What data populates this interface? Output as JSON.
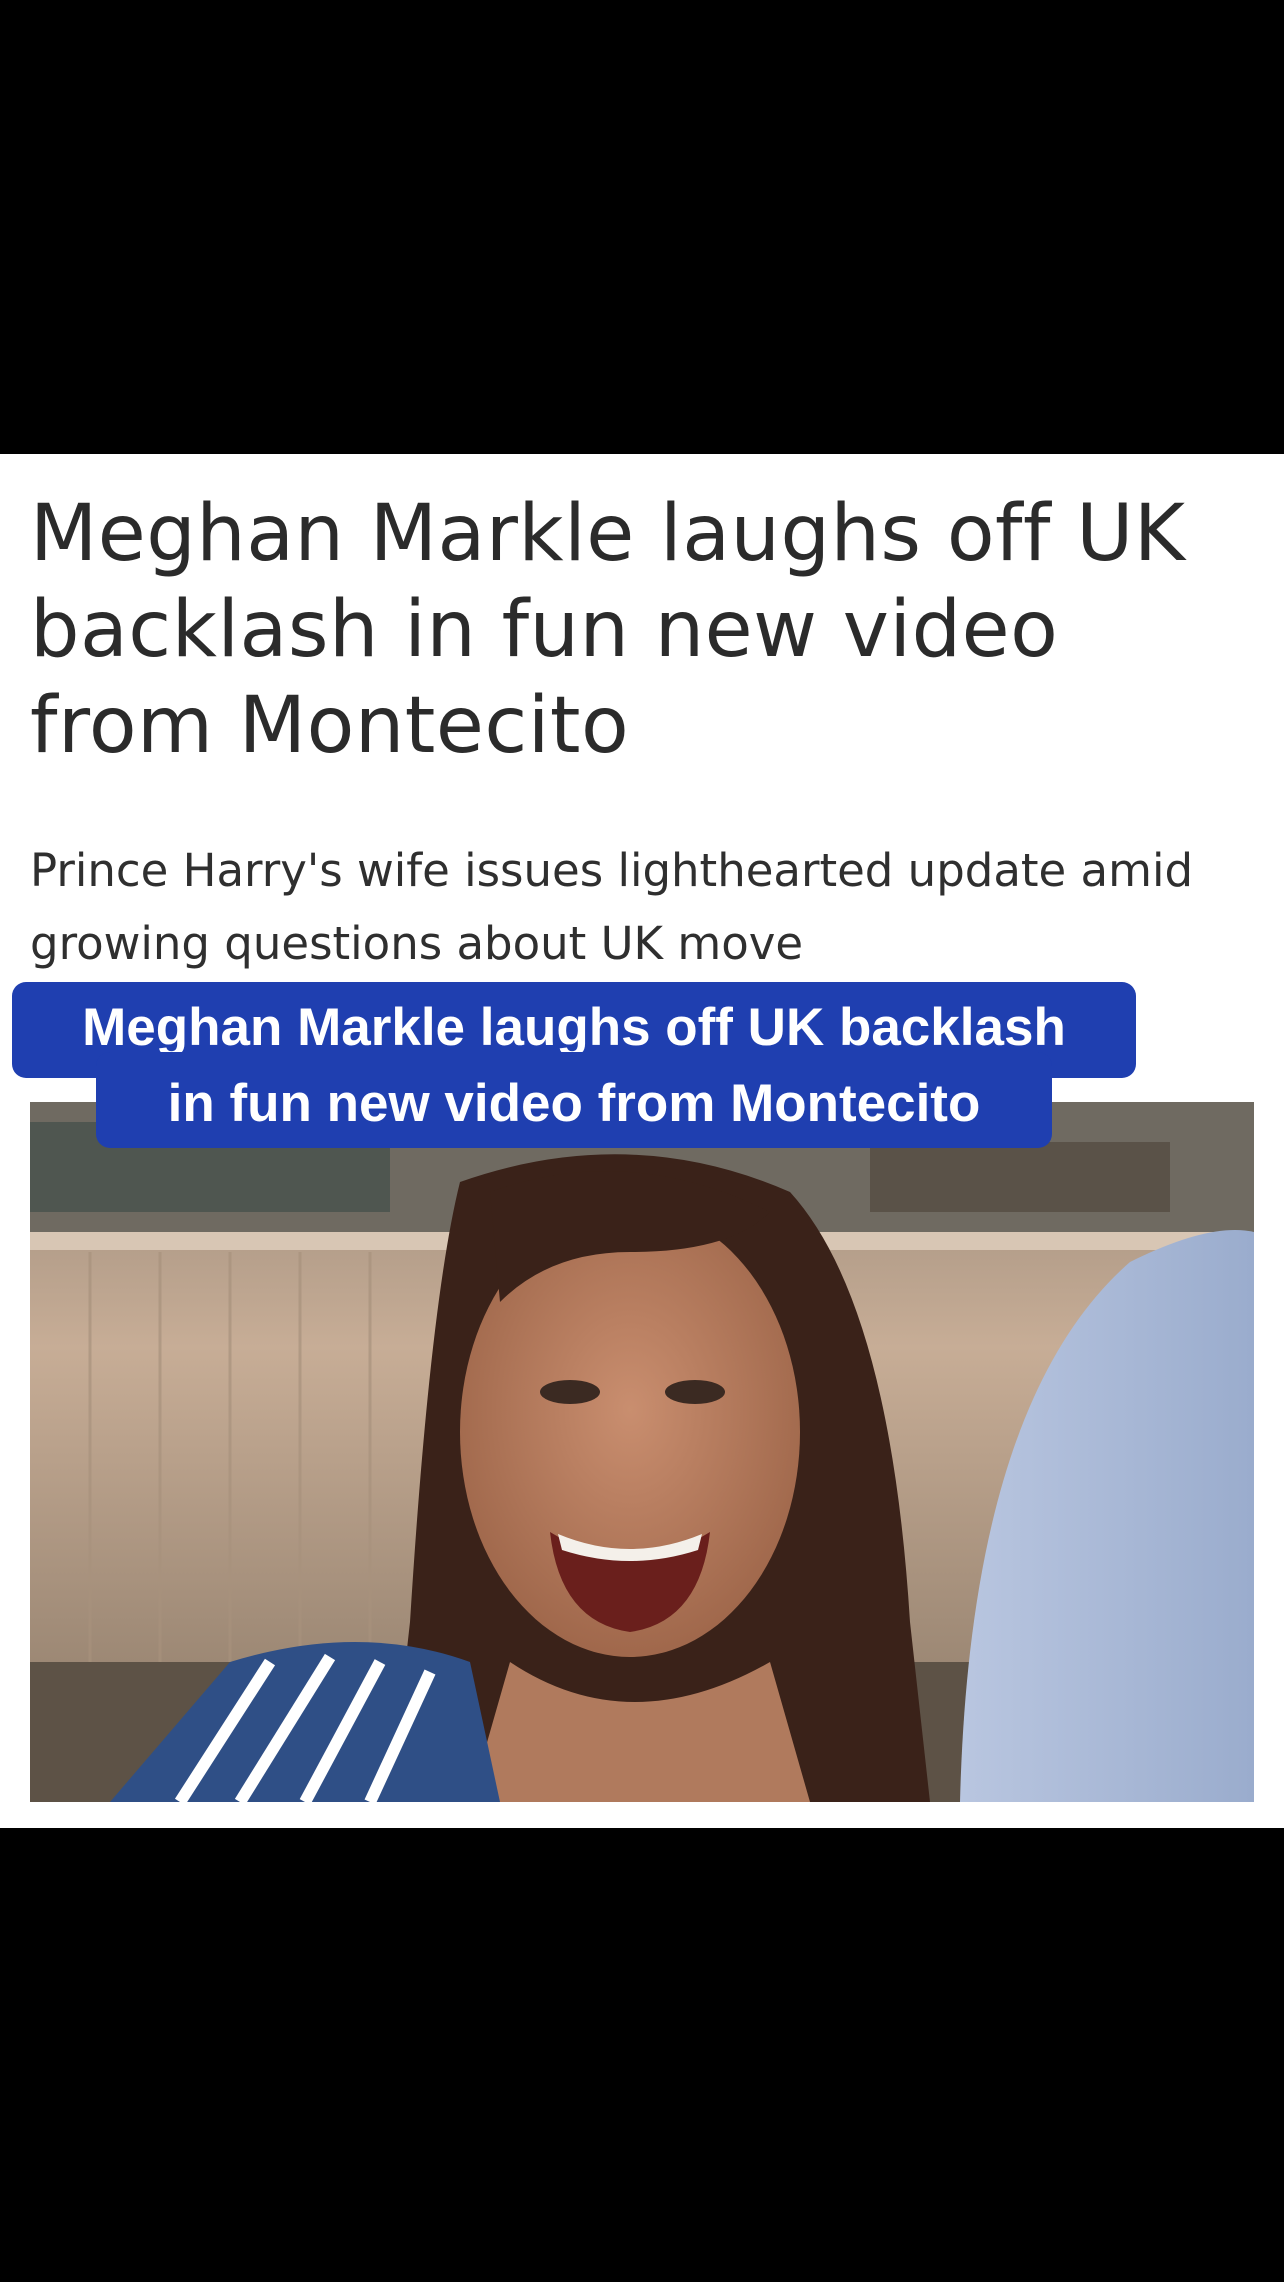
{
  "article": {
    "headline": "Meghan Markle laughs off UK backlash in fun new video from Montecito",
    "subheadline": "Prince Harry's wife issues lighthearted update amid growing questions about UK move"
  },
  "video": {
    "caption_line_1": "Meghan Markle laughs off UK backlash",
    "caption_line_2": "in fun new video from Montecito",
    "caption_color": "#1f3fb0"
  },
  "colors": {
    "background": "#000000",
    "card": "#ffffff",
    "headline_text": "#2b2b2b"
  }
}
